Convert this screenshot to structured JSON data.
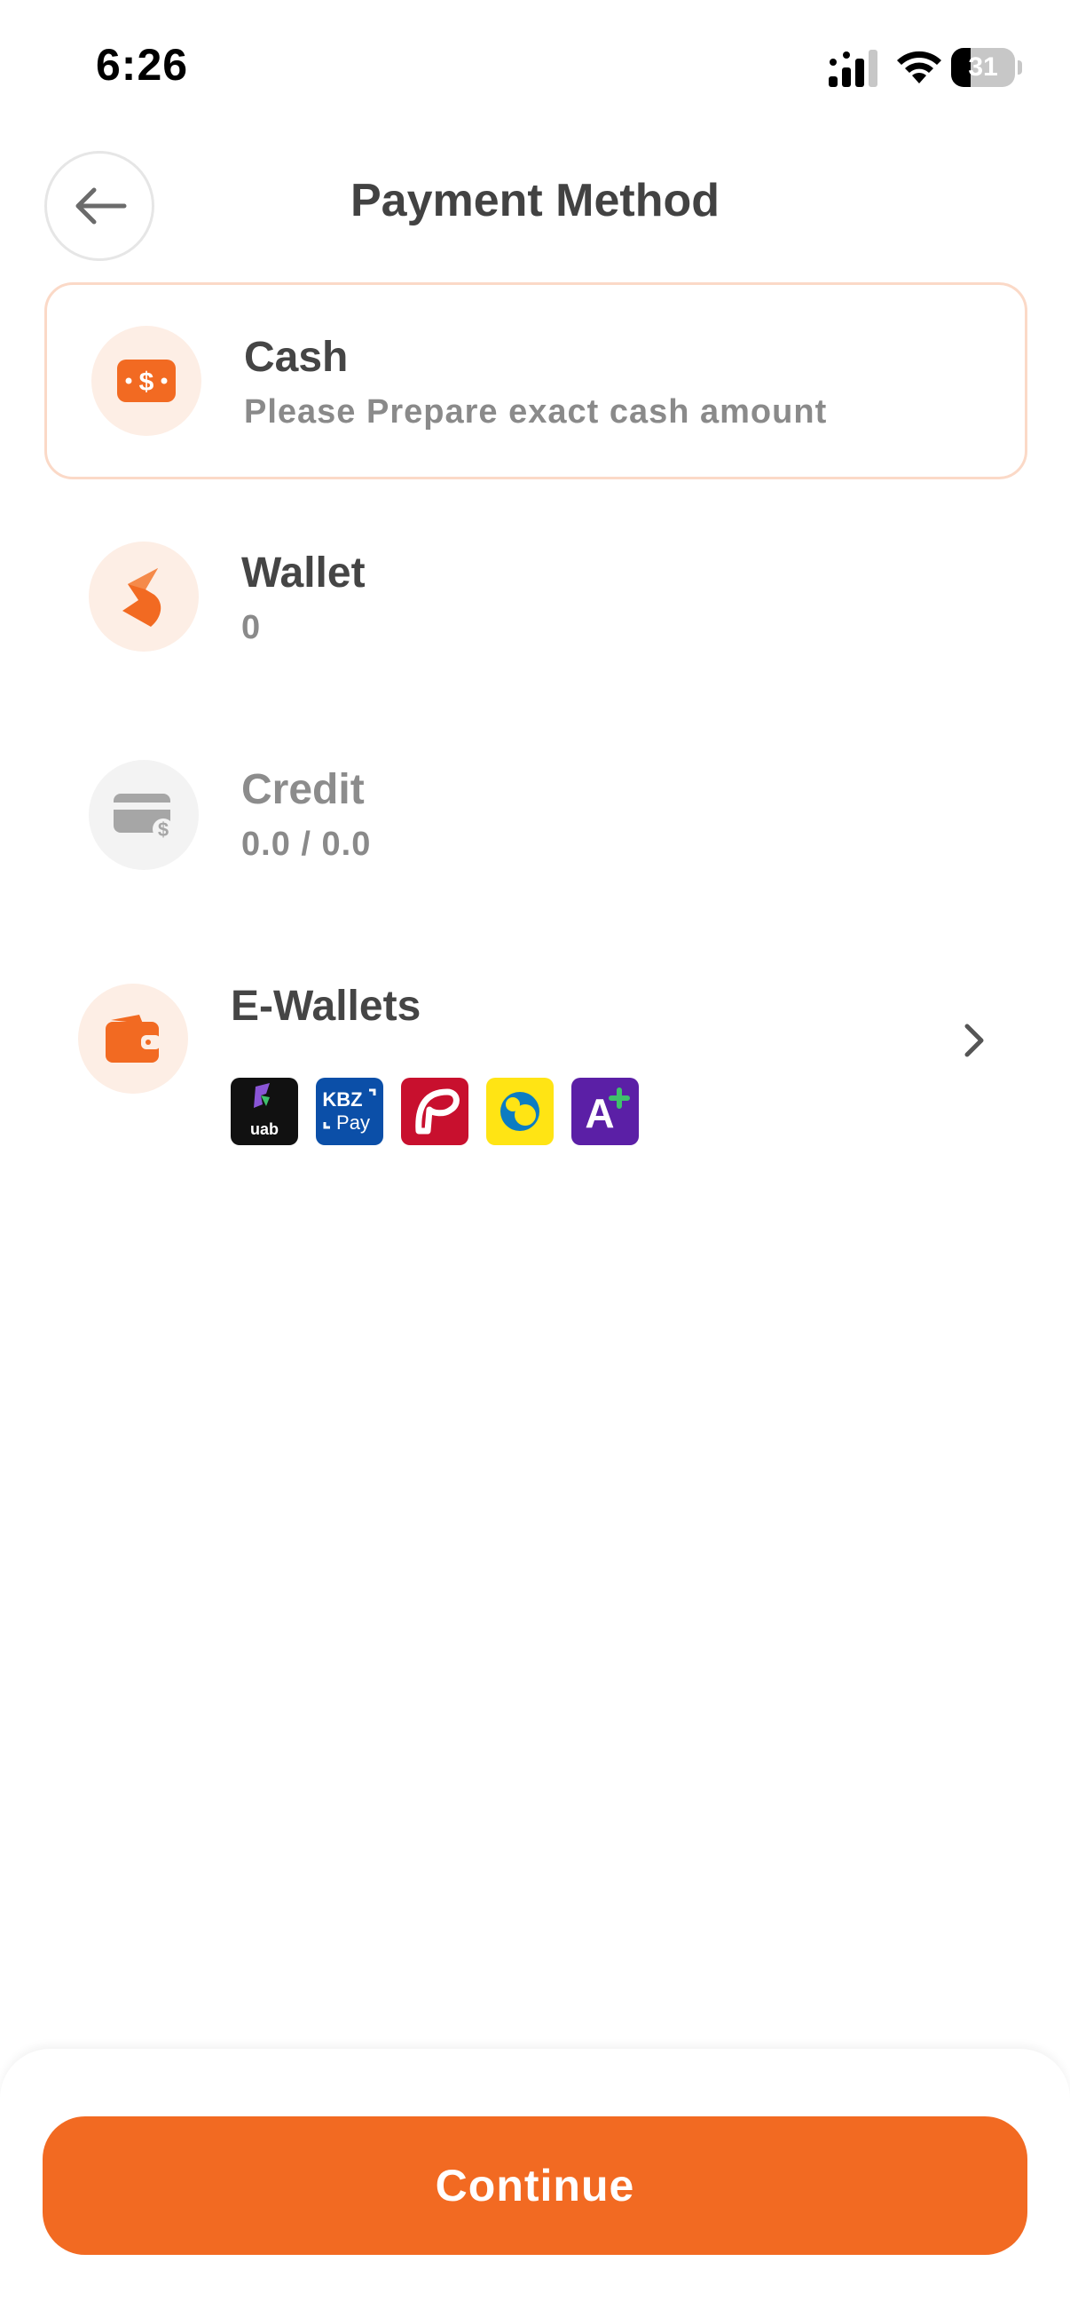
{
  "status_bar": {
    "time": "6:26",
    "battery_level": "31",
    "battery_fraction": 0.31
  },
  "header": {
    "title": "Payment Method",
    "back_icon": "arrow-left-icon"
  },
  "options": [
    {
      "id": "cash",
      "title": "Cash",
      "subtitle": "Please Prepare exact cash amount",
      "icon": "cash-icon",
      "selected": true,
      "enabled": true
    },
    {
      "id": "wallet",
      "title": "Wallet",
      "subtitle": "0",
      "icon": "wallet-app-icon",
      "selected": false,
      "enabled": true
    },
    {
      "id": "credit",
      "title": "Credit",
      "subtitle": "0.0 / 0.0",
      "icon": "credit-card-icon",
      "selected": false,
      "enabled": false
    },
    {
      "id": "ewallets",
      "title": "E-Wallets",
      "icon": "ewallet-icon",
      "selected": false,
      "enabled": true
    }
  ],
  "ewallet_logos": [
    {
      "name": "uabpay-logo",
      "text": "uab pay"
    },
    {
      "name": "kbzpay-logo",
      "text": "KBZ Pay"
    },
    {
      "name": "ayapay-logo",
      "text": ""
    },
    {
      "name": "cbpay-logo",
      "text": ""
    },
    {
      "name": "aplus-logo",
      "text": "A"
    }
  ],
  "colors": {
    "accent": "#f26a22",
    "accent_soft": "#fdeee5",
    "disabled": "#a6a6a6",
    "disabled_soft": "#f3f3f3",
    "selected_border": "#fbd9c7"
  },
  "footer": {
    "continue_label": "Continue"
  }
}
